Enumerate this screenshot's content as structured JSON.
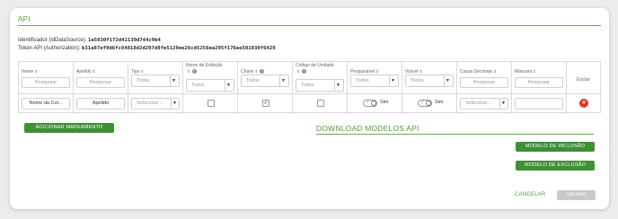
{
  "title": "API",
  "info": {
    "id_label": "Identificador (idDataSource):",
    "id_value": "1e5930f172d41139d744c9b4",
    "token_label": "Token API (Authorization):",
    "token_value": "b31a87ef9d6fc84818d2d207d8fe5129ee26cd5256ea295f176ee501030f6429"
  },
  "columns": [
    {
      "label": "Nome",
      "sort": "⇕",
      "filter_placeholder": "Pesquisar"
    },
    {
      "label": "Apelido",
      "sort": "⇕",
      "filter_placeholder": "Pesquisar"
    },
    {
      "label": "Tipo",
      "sort": "⇕",
      "filter_value": "Todos"
    },
    {
      "label": "Nome de Exibição",
      "sort": "⇕",
      "filter_value": "Todos"
    },
    {
      "label": "Chave",
      "sort": "⇕",
      "filter_value": "Todos"
    },
    {
      "label": "Código de Unidade",
      "sort": "⇕",
      "filter_value": "Todos"
    },
    {
      "label": "Pesquisável",
      "sort": "⇕",
      "filter_value": "Todos"
    },
    {
      "label": "Visível",
      "sort": "⇕",
      "filter_value": "Todos"
    },
    {
      "label": "Casas Decimais",
      "sort": "⇕",
      "filter_placeholder": "Pesquisar"
    },
    {
      "label": "Máscara",
      "sort": "⇕",
      "filter_placeholder": "Pesquisar"
    },
    {
      "label": "Excluir"
    }
  ],
  "help_glyph": "?",
  "row": {
    "nome": "Nome da Col...",
    "apelido": "Apelido",
    "tipo": "Selecione...",
    "nome_exibicao_checked": false,
    "chave_checked": true,
    "codigo_unidade_checked": false,
    "pesquisavel": "Sim",
    "visivel": "Sim",
    "casas_decimais": "Selecione...",
    "mascara": ""
  },
  "buttons": {
    "add_mapping": "ADICIONAR MAPEAMENTO",
    "download_title": "DOWNLOAD MODELOS API",
    "insert_model": "MODELO DE INCLUSÃO",
    "delete_model": "MODELO DE EXCLUSÃO",
    "cancel": "CANCELAR",
    "save": "SALVAR"
  },
  "colors": {
    "accent": "#4a9f3c",
    "button_green": "#3f8f35",
    "delete_red": "#d9342b",
    "disabled_gray": "#c9c9c9"
  }
}
